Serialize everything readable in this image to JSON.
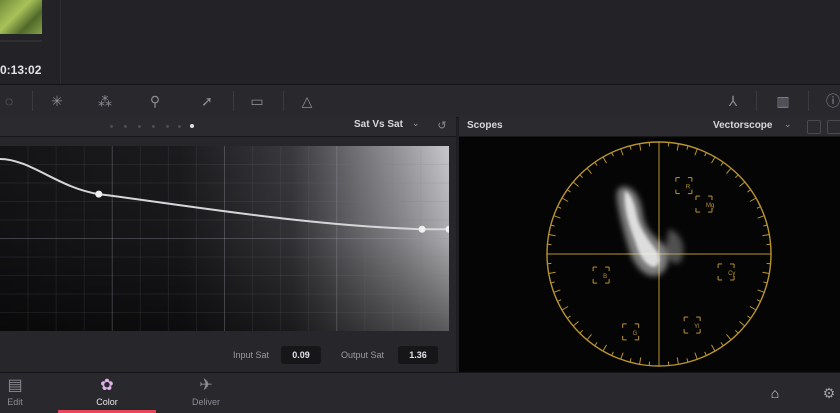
{
  "media": {
    "timecode": "0:13:02"
  },
  "toolbar": {
    "left_icons": [
      "color-wheel-icon",
      "target-icon",
      "nodes-icon",
      "eyedropper-icon",
      "arrow-icon",
      "crop-box-icon",
      "triangle-warning-icon"
    ],
    "right_icons": [
      "magic-mask-icon",
      "chart-icon",
      "info-icon"
    ]
  },
  "curves": {
    "mode_label": "Sat Vs Sat",
    "curve_points": [
      {
        "input": 0.0,
        "output": 0.93
      },
      {
        "input": 0.22,
        "output": 0.74
      },
      {
        "input": 0.94,
        "output": 0.55
      },
      {
        "input": 1.0,
        "output": 0.55
      }
    ],
    "input_sat_label": "Input Sat",
    "input_sat_value": "0.09",
    "output_sat_label": "Output Sat",
    "output_sat_value": "1.36"
  },
  "scopes": {
    "title": "Scopes",
    "mode_label": "Vectorscope",
    "targets": [
      "R",
      "Mg",
      "B",
      "Cy",
      "G",
      "Yl"
    ],
    "graticule_color": "#b8942e"
  },
  "pages": {
    "edit_label": "Edit",
    "color_label": "Color",
    "deliver_label": "Deliver",
    "active_page": "Color",
    "accent_color": "#e8445a"
  }
}
